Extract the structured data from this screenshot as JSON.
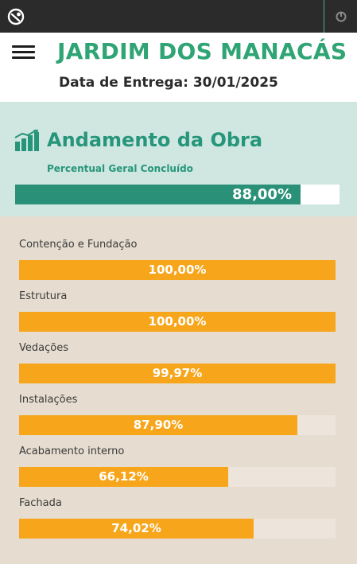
{
  "header": {
    "title": "JARDIM DOS MANACÁS",
    "delivery": "Data de Entrega: 30/01/2025"
  },
  "overall": {
    "title": "Andamento da Obra",
    "subtitle": "Percentual Geral Concluído",
    "percent_label": "88,00%",
    "percent_value": 88.0
  },
  "stages": [
    {
      "label": "Contenção e Fundação",
      "percent_label": "100,00%",
      "percent_value": 100.0
    },
    {
      "label": "Estrutura",
      "percent_label": "100,00%",
      "percent_value": 100.0
    },
    {
      "label": "Vedações",
      "percent_label": "99,97%",
      "percent_value": 99.97
    },
    {
      "label": "Instalações",
      "percent_label": "87,90%",
      "percent_value": 87.9
    },
    {
      "label": "Acabamento interno",
      "percent_label": "66,12%",
      "percent_value": 66.12
    },
    {
      "label": "Fachada",
      "percent_label": "74,02%",
      "percent_value": 74.02
    }
  ],
  "colors": {
    "brand_green": "#2fa474",
    "overall_fill": "#2a9178",
    "stage_fill": "#f7a61c"
  },
  "icons": {
    "app_logo": "logo-icon",
    "menu": "hamburger-menu-icon",
    "power": "power-icon",
    "chart": "bar-chart-icon"
  }
}
